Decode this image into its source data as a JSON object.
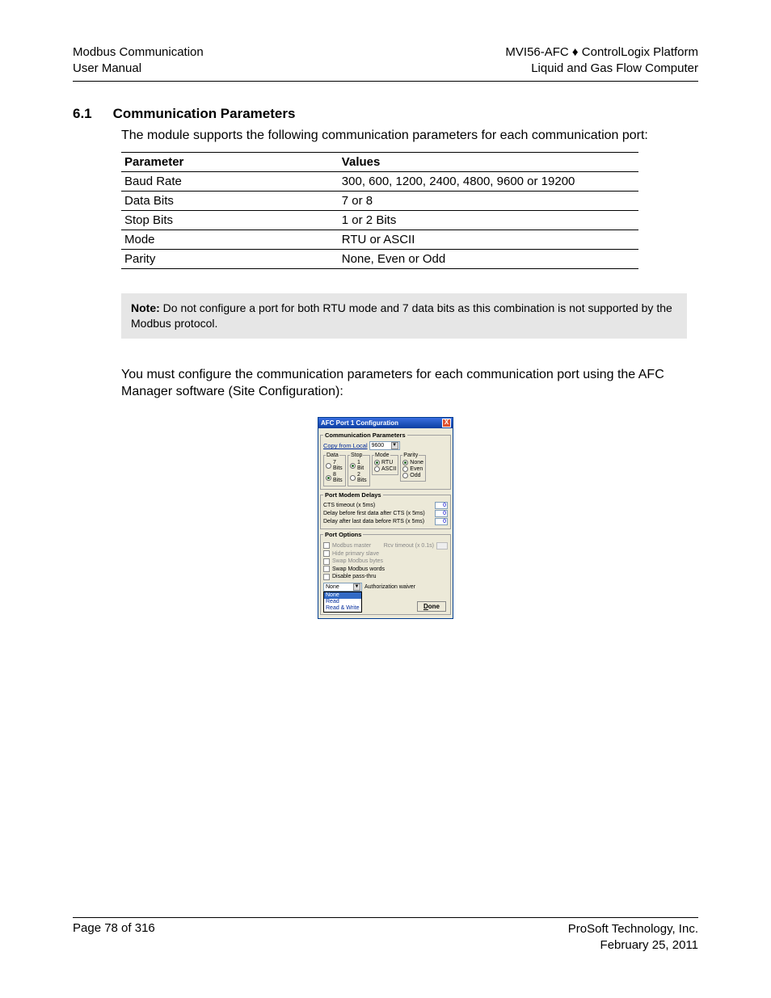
{
  "header": {
    "left1": "Modbus Communication",
    "left2": "User Manual",
    "right1a": "MVI56-AFC",
    "right1sep": " ♦ ",
    "right1b": "ControlLogix Platform",
    "right2": "Liquid and Gas Flow Computer"
  },
  "section": {
    "number": "6.1",
    "title": "Communication Parameters",
    "intro": "The module supports the following communication parameters for each communication port:"
  },
  "table": {
    "head_param": "Parameter",
    "head_values": "Values",
    "rows": [
      {
        "p": "Baud Rate",
        "v": "300, 600, 1200, 2400, 4800, 9600 or 19200"
      },
      {
        "p": "Data Bits",
        "v": "7 or 8"
      },
      {
        "p": "Stop Bits",
        "v": "1 or 2 Bits"
      },
      {
        "p": "Mode",
        "v": "RTU or ASCII"
      },
      {
        "p": "Parity",
        "v": "None, Even or Odd"
      }
    ]
  },
  "note": {
    "label": "Note:",
    "text": " Do not configure a port for both RTU mode and 7 data bits as this combination is not supported by the Modbus protocol."
  },
  "para2": "You must configure the communication parameters for each communication port using the AFC Manager software (Site Configuration):",
  "dialog": {
    "title": "AFC Port 1 Configuration",
    "close": "X",
    "cp_legend": "Communication Parameters",
    "copy_label": "Copy from Local",
    "baud": "9600",
    "data_legend": "Data",
    "data_7": "7 Bits",
    "data_8": "8 Bits",
    "stop_legend": "Stop",
    "stop_1": "1 Bit",
    "stop_2": "2 Bits",
    "mode_legend": "Mode",
    "mode_rtu": "RTU",
    "mode_ascii": "ASCII",
    "parity_legend": "Parity",
    "parity_none": "None",
    "parity_even": "Even",
    "parity_odd": "Odd",
    "pmd_legend": "Port Modem Delays",
    "pmd_1": "CTS timeout (x 5ms)",
    "pmd_2": "Delay before first data after CTS (x 5ms)",
    "pmd_3": "Delay after last data before RTS (x 5ms)",
    "pmd_val": "0",
    "po_legend": "Port Options",
    "po_1": "Modbus master",
    "po_1b": "Rcv timeout (x 0.1s)",
    "po_2": "Hide primary slave",
    "po_3": "Swap Modbus bytes",
    "po_4": "Swap Modbus words",
    "po_5": "Disable pass-thru",
    "auth_sel": "None",
    "auth_label": "Authorization waiver",
    "auth_opts": [
      "None",
      "Read",
      "Read & Write"
    ],
    "done": "one",
    "done_u": "D"
  },
  "footer": {
    "page": "Page 78 of 316",
    "company": "ProSoft Technology, Inc.",
    "date": "February 25, 2011"
  }
}
